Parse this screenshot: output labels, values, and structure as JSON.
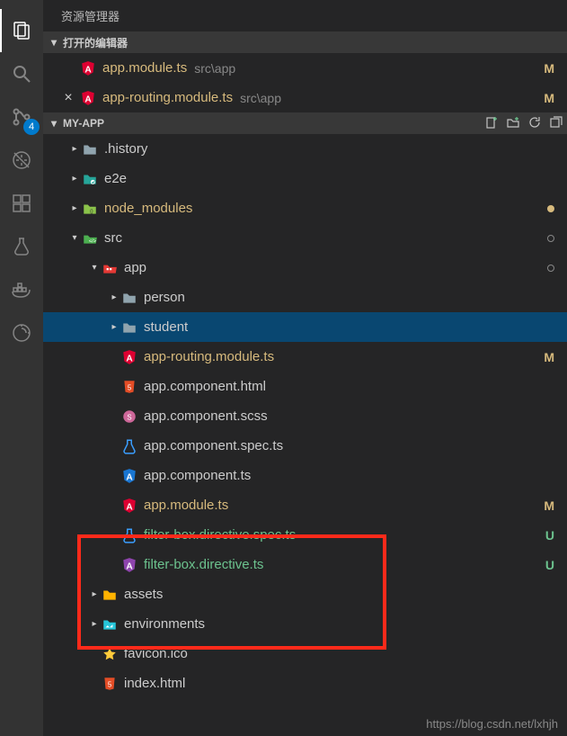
{
  "title": "资源管理器",
  "openEditorsHeader": "打开的编辑器",
  "folderHeader": "MY-APP",
  "scmBadge": "4",
  "watermark": "https://blog.csdn.net/lxhjh",
  "openEditors": [
    {
      "name": "app.module.ts",
      "path": "src\\app",
      "status": "M",
      "icon": "angular",
      "hasClose": false
    },
    {
      "name": "app-routing.module.ts",
      "path": "src\\app",
      "status": "M",
      "icon": "angular",
      "hasClose": true
    }
  ],
  "tree": [
    {
      "d": 0,
      "t": "folder",
      "exp": false,
      "name": ".history",
      "icon": "folder-grey"
    },
    {
      "d": 0,
      "t": "folder",
      "exp": false,
      "name": "e2e",
      "icon": "folder-teal"
    },
    {
      "d": 0,
      "t": "folder",
      "exp": false,
      "name": "node_modules",
      "icon": "folder-green",
      "cls": "yellow",
      "dot": "y"
    },
    {
      "d": 0,
      "t": "folder",
      "exp": true,
      "name": "src",
      "icon": "folder-green-open",
      "dot": "o"
    },
    {
      "d": 1,
      "t": "folder",
      "exp": true,
      "name": "app",
      "icon": "folder-red-open",
      "dot": "o"
    },
    {
      "d": 2,
      "t": "folder",
      "exp": false,
      "name": "person",
      "icon": "folder-grey"
    },
    {
      "d": 2,
      "t": "folder",
      "exp": false,
      "name": "student",
      "icon": "folder-grey",
      "sel": true
    },
    {
      "d": 2,
      "t": "file",
      "name": "app-routing.module.ts",
      "icon": "angular",
      "status": "M",
      "cls": "yellow"
    },
    {
      "d": 2,
      "t": "file",
      "name": "app.component.html",
      "icon": "html"
    },
    {
      "d": 2,
      "t": "file",
      "name": "app.component.scss",
      "icon": "scss"
    },
    {
      "d": 2,
      "t": "file",
      "name": "app.component.spec.ts",
      "icon": "spec"
    },
    {
      "d": 2,
      "t": "file",
      "name": "app.component.ts",
      "icon": "angular-blue"
    },
    {
      "d": 2,
      "t": "file",
      "name": "app.module.ts",
      "icon": "angular",
      "status": "M",
      "cls": "yellow"
    },
    {
      "d": 2,
      "t": "file",
      "name": "filter-box.directive.spec.ts",
      "icon": "spec",
      "status": "U",
      "cls": "green"
    },
    {
      "d": 2,
      "t": "file",
      "name": "filter-box.directive.ts",
      "icon": "angular-purple",
      "status": "U",
      "cls": "green"
    },
    {
      "d": 1,
      "t": "folder",
      "exp": false,
      "name": "assets",
      "icon": "folder-yellow"
    },
    {
      "d": 1,
      "t": "folder",
      "exp": false,
      "name": "environments",
      "icon": "folder-pic"
    },
    {
      "d": 1,
      "t": "file",
      "name": "favicon.ico",
      "icon": "star"
    },
    {
      "d": 1,
      "t": "file",
      "name": "index.html",
      "icon": "html"
    }
  ]
}
